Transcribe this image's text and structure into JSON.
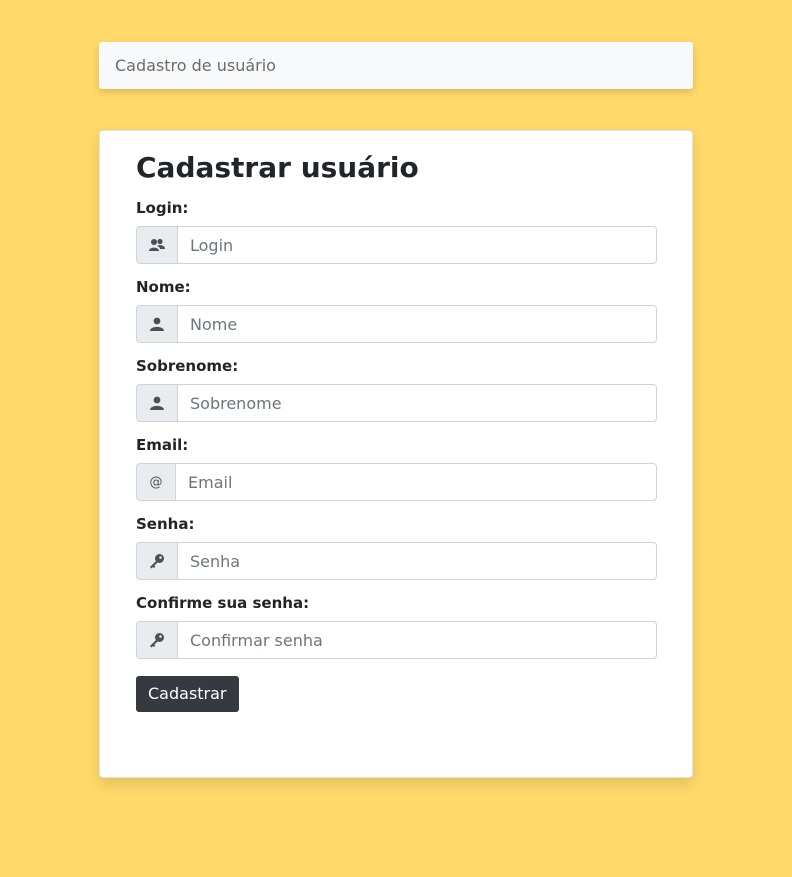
{
  "navbar": {
    "brand": "Cadastro de usuário"
  },
  "form": {
    "title": "Cadastrar usuário",
    "fields": {
      "login": {
        "label": "Login:",
        "placeholder": "Login",
        "icon": "users-icon"
      },
      "nome": {
        "label": "Nome:",
        "placeholder": "Nome",
        "icon": "user-icon"
      },
      "sobrenome": {
        "label": "Sobrenome:",
        "placeholder": "Sobrenome",
        "icon": "user-icon"
      },
      "email": {
        "label": "Email:",
        "placeholder": "Email",
        "addon": "@",
        "icon": "at-icon"
      },
      "senha": {
        "label": "Senha:",
        "placeholder": "Senha",
        "icon": "key-icon"
      },
      "confirmar": {
        "label": "Confirme sua senha:",
        "placeholder": "Confirmar senha",
        "icon": "key-icon"
      }
    },
    "submit_label": "Cadastrar"
  },
  "colors": {
    "background": "#ffd96a",
    "button": "#343a40"
  }
}
